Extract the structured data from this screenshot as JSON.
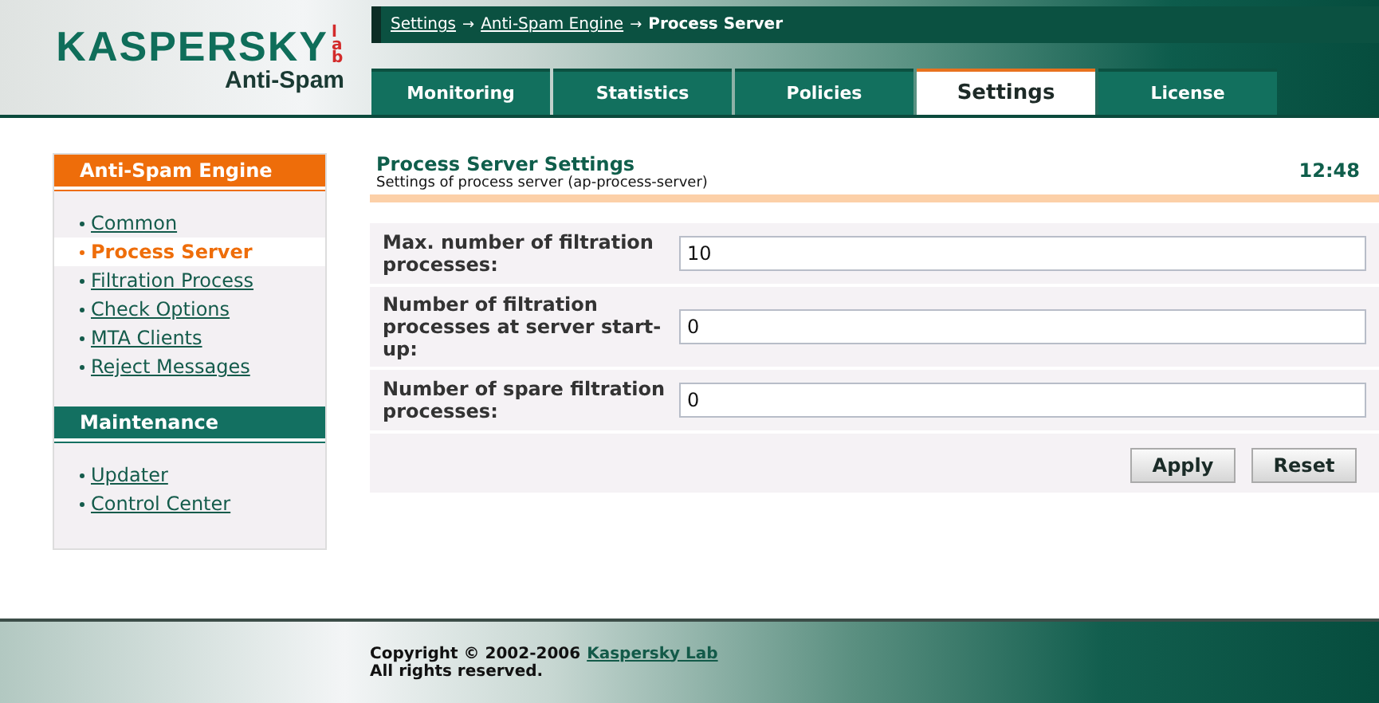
{
  "logo": {
    "brand": "KASPERSKY",
    "lab": "lab",
    "product": "Anti-Spam"
  },
  "breadcrumb": [
    {
      "label": "Settings",
      "link": true
    },
    {
      "label": "Anti-Spam Engine",
      "link": true
    },
    {
      "label": "Process Server",
      "link": false
    }
  ],
  "separator": "→",
  "tabs": [
    {
      "label": "Monitoring",
      "selected": false
    },
    {
      "label": "Statistics",
      "selected": false
    },
    {
      "label": "Policies",
      "selected": false
    },
    {
      "label": "Settings",
      "selected": true
    },
    {
      "label": "License",
      "selected": false
    }
  ],
  "sidebar": [
    {
      "title": "Anti-Spam Engine",
      "kind": "orange",
      "items": [
        {
          "label": "Common",
          "selected": false
        },
        {
          "label": "Process Server",
          "selected": true
        },
        {
          "label": "Filtration Process",
          "selected": false
        },
        {
          "label": "Check Options",
          "selected": false
        },
        {
          "label": "MTA Clients",
          "selected": false
        },
        {
          "label": "Reject Messages",
          "selected": false
        }
      ]
    },
    {
      "title": "Maintenance",
      "kind": "green",
      "items": [
        {
          "label": "Updater",
          "selected": false
        },
        {
          "label": "Control Center",
          "selected": false
        }
      ]
    }
  ],
  "page": {
    "title": "Process Server Settings",
    "subtitle": "Settings of process server (ap-process-server)",
    "time": "12:48"
  },
  "fields": [
    {
      "label": "Max. number of filtration processes:",
      "value": "10"
    },
    {
      "label": "Number of filtration processes at server start-up:",
      "value": "0"
    },
    {
      "label": "Number of spare filtration processes:",
      "value": "0"
    }
  ],
  "buttons": [
    "Apply",
    "Reset"
  ],
  "footer": {
    "copyright": "Copyright © 2002-2006",
    "link": "Kaspersky Lab",
    "rights": "All rights reserved."
  }
}
